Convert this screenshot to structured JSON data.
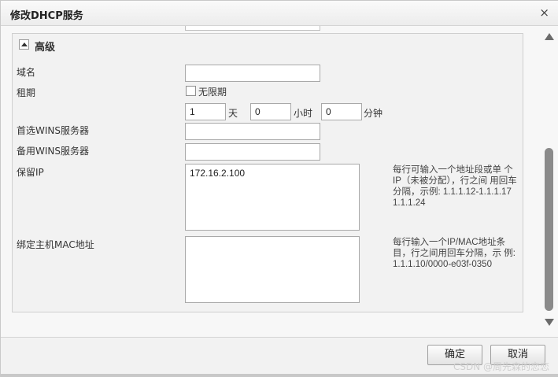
{
  "dialog": {
    "title": "修改DHCP服务",
    "close_glyph": "×"
  },
  "section": {
    "title": "高级"
  },
  "fields": {
    "domain": {
      "label": "域名",
      "value": ""
    },
    "lease": {
      "label": "租期",
      "unlimited_label": "无限期",
      "unlimited_checked": false,
      "days_value": "1",
      "days_unit": "天",
      "hours_value": "0",
      "hours_unit": "小时",
      "minutes_value": "0",
      "minutes_unit": "分钟"
    },
    "primary_wins": {
      "label": "首选WINS服务器",
      "value": ""
    },
    "backup_wins": {
      "label": "备用WINS服务器",
      "value": ""
    },
    "reserved_ip": {
      "label": "保留IP",
      "value": "172.16.2.100",
      "hint": "每行可输入一个地址段或单\n个IP（未被分配），行之间\n用回车分隔，示例:\n1.1.1.12-1.1.1.17\n1.1.1.24"
    },
    "bind_mac": {
      "label": "绑定主机MAC地址",
      "value": "",
      "hint": "每行输入一个IP/MAC地址条\n目，行之间用回车分隔，示\n例:\n1.1.1.10/0000-e03f-0350"
    }
  },
  "buttons": {
    "ok": "确定",
    "cancel": "取消"
  },
  "watermark": "CSDN @周先森的恋恋",
  "icons": {
    "close": "close-icon",
    "collapse": "collapse-toggle-icon",
    "scroll_up": "scroll-up-icon",
    "scroll_down": "scroll-down-icon"
  }
}
